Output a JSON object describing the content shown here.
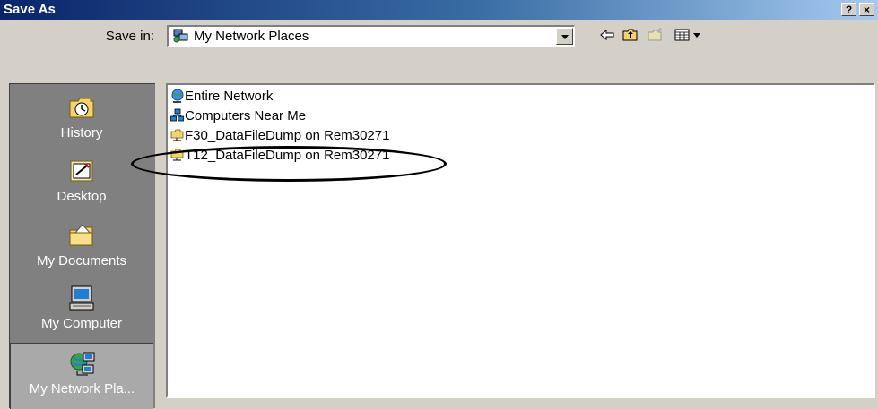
{
  "window": {
    "title": "Save As",
    "help_label": "?",
    "close_label": "×"
  },
  "toolbar": {
    "save_in_label": "Save in:",
    "location": "My Network Places",
    "icons": [
      "back-arrow-icon",
      "up-folder-icon",
      "new-folder-icon",
      "view-menu-icon"
    ]
  },
  "places": [
    {
      "label": "History",
      "icon": "history-icon"
    },
    {
      "label": "Desktop",
      "icon": "desktop-icon"
    },
    {
      "label": "My Documents",
      "icon": "my-documents-icon"
    },
    {
      "label": "My Computer",
      "icon": "my-computer-icon"
    },
    {
      "label": "My Network Pla...",
      "icon": "my-network-places-icon",
      "selected": true
    }
  ],
  "files": [
    {
      "name": "Entire Network",
      "icon": "entire-network-icon"
    },
    {
      "name": "Computers Near Me",
      "icon": "computers-near-me-icon"
    },
    {
      "name": "F30_DataFileDump on Rem30271",
      "icon": "network-folder-icon"
    },
    {
      "name": "T12_DataFileDump on Rem30271",
      "icon": "network-folder-icon",
      "circled": true
    }
  ]
}
